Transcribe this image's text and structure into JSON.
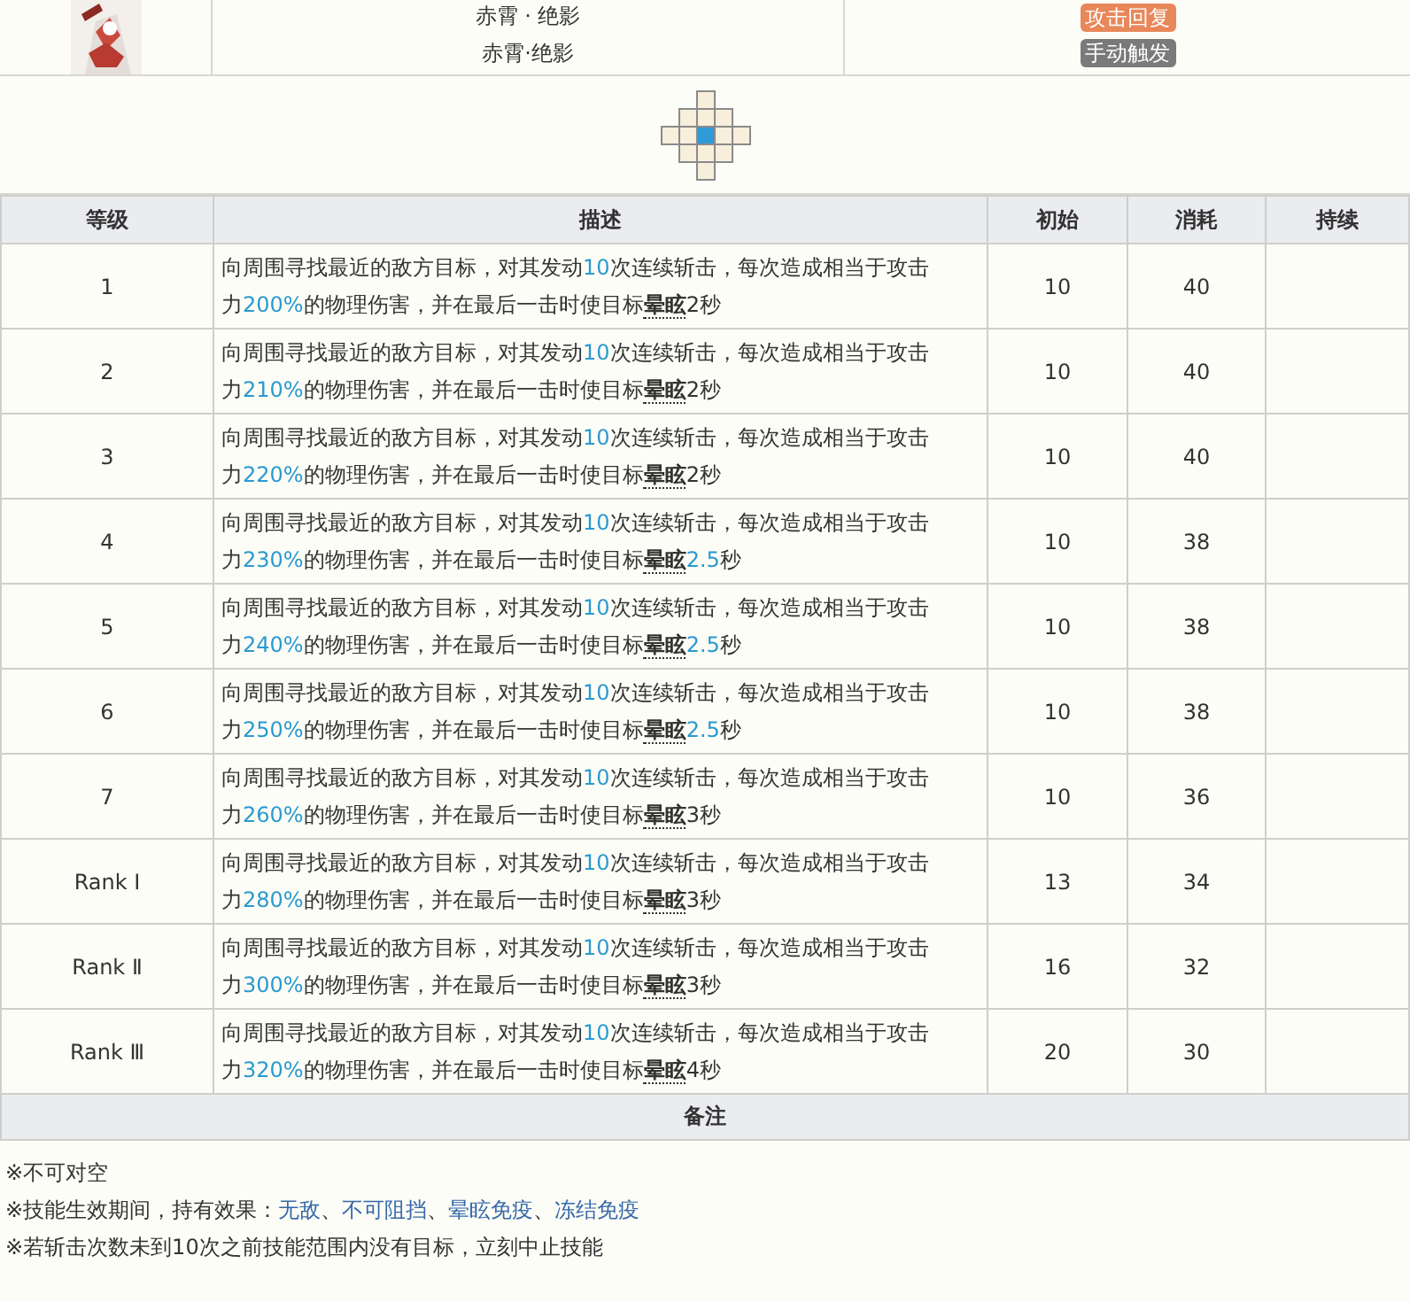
{
  "skill_header": {
    "image": {
      "kind": "picture"
    },
    "names": [
      "赤霄 · 绝影",
      "赤霄·绝影"
    ],
    "tags": [
      {
        "label": "攻击回复",
        "color": "#e8875a"
      },
      {
        "label": "手动触发",
        "color": "#7a7a7a"
      }
    ]
  },
  "range_grid": [
    [
      {
        "in_range": false,
        "self": false
      },
      {
        "in_range": false,
        "self": false
      },
      {
        "in_range": true,
        "self": false
      },
      {
        "in_range": false,
        "self": false
      },
      {
        "in_range": false,
        "self": false
      }
    ],
    [
      {
        "in_range": false,
        "self": false
      },
      {
        "in_range": true,
        "self": false
      },
      {
        "in_range": true,
        "self": false
      },
      {
        "in_range": true,
        "self": false
      },
      {
        "in_range": false,
        "self": false
      }
    ],
    [
      {
        "in_range": true,
        "self": false
      },
      {
        "in_range": true,
        "self": false
      },
      {
        "in_range": true,
        "self": true
      },
      {
        "in_range": true,
        "self": false
      },
      {
        "in_range": true,
        "self": false
      }
    ],
    [
      {
        "in_range": false,
        "self": false
      },
      {
        "in_range": true,
        "self": false
      },
      {
        "in_range": true,
        "self": false
      },
      {
        "in_range": true,
        "self": false
      },
      {
        "in_range": false,
        "self": false
      }
    ],
    [
      {
        "in_range": false,
        "self": false
      },
      {
        "in_range": false,
        "self": false
      },
      {
        "in_range": true,
        "self": false
      },
      {
        "in_range": false,
        "self": false
      },
      {
        "in_range": false,
        "self": false
      }
    ]
  ],
  "table": {
    "columns": [
      "等级",
      "描述",
      "初始",
      "消耗",
      "持续"
    ],
    "rows": [
      {
        "level": "1",
        "description": [
          {
            "kind": "plain",
            "text": "向周围寻找最近的敌方目标，对其发动"
          },
          {
            "kind": "value",
            "text": "10"
          },
          {
            "kind": "plain",
            "text": "次连续斩击，每次造成相当于攻击力"
          },
          {
            "kind": "value",
            "text": "200%"
          },
          {
            "kind": "plain",
            "text": "的物理伤害，并在最后一击时使目标"
          },
          {
            "kind": "term",
            "text": "晕眩"
          },
          {
            "kind": "plain",
            "text": "2秒"
          }
        ],
        "initial": "10",
        "cost": "40"
      },
      {
        "level": "2",
        "description": [
          {
            "kind": "plain",
            "text": "向周围寻找最近的敌方目标，对其发动"
          },
          {
            "kind": "value",
            "text": "10"
          },
          {
            "kind": "plain",
            "text": "次连续斩击，每次造成相当于攻击力"
          },
          {
            "kind": "value",
            "text": "210%"
          },
          {
            "kind": "plain",
            "text": "的物理伤害，并在最后一击时使目标"
          },
          {
            "kind": "term",
            "text": "晕眩"
          },
          {
            "kind": "plain",
            "text": "2秒"
          }
        ],
        "initial": "10",
        "cost": "40"
      },
      {
        "level": "3",
        "description": [
          {
            "kind": "plain",
            "text": "向周围寻找最近的敌方目标，对其发动"
          },
          {
            "kind": "value",
            "text": "10"
          },
          {
            "kind": "plain",
            "text": "次连续斩击，每次造成相当于攻击力"
          },
          {
            "kind": "value",
            "text": "220%"
          },
          {
            "kind": "plain",
            "text": "的物理伤害，并在最后一击时使目标"
          },
          {
            "kind": "term",
            "text": "晕眩"
          },
          {
            "kind": "plain",
            "text": "2秒"
          }
        ],
        "initial": "10",
        "cost": "40"
      },
      {
        "level": "4",
        "description": [
          {
            "kind": "plain",
            "text": "向周围寻找最近的敌方目标，对其发动"
          },
          {
            "kind": "value",
            "text": "10"
          },
          {
            "kind": "plain",
            "text": "次连续斩击，每次造成相当于攻击力"
          },
          {
            "kind": "value",
            "text": "230%"
          },
          {
            "kind": "plain",
            "text": "的物理伤害，并在最后一击时使目标"
          },
          {
            "kind": "term",
            "text": "晕眩"
          },
          {
            "kind": "value",
            "text": "2.5"
          },
          {
            "kind": "plain",
            "text": "秒"
          }
        ],
        "initial": "10",
        "cost": "38"
      },
      {
        "level": "5",
        "description": [
          {
            "kind": "plain",
            "text": "向周围寻找最近的敌方目标，对其发动"
          },
          {
            "kind": "value",
            "text": "10"
          },
          {
            "kind": "plain",
            "text": "次连续斩击，每次造成相当于攻击力"
          },
          {
            "kind": "value",
            "text": "240%"
          },
          {
            "kind": "plain",
            "text": "的物理伤害，并在最后一击时使目标"
          },
          {
            "kind": "term",
            "text": "晕眩"
          },
          {
            "kind": "value",
            "text": "2.5"
          },
          {
            "kind": "plain",
            "text": "秒"
          }
        ],
        "initial": "10",
        "cost": "38"
      },
      {
        "level": "6",
        "description": [
          {
            "kind": "plain",
            "text": "向周围寻找最近的敌方目标，对其发动"
          },
          {
            "kind": "value",
            "text": "10"
          },
          {
            "kind": "plain",
            "text": "次连续斩击，每次造成相当于攻击力"
          },
          {
            "kind": "value",
            "text": "250%"
          },
          {
            "kind": "plain",
            "text": "的物理伤害，并在最后一击时使目标"
          },
          {
            "kind": "term",
            "text": "晕眩"
          },
          {
            "kind": "value",
            "text": "2.5"
          },
          {
            "kind": "plain",
            "text": "秒"
          }
        ],
        "initial": "10",
        "cost": "38"
      },
      {
        "level": "7",
        "description": [
          {
            "kind": "plain",
            "text": "向周围寻找最近的敌方目标，对其发动"
          },
          {
            "kind": "value",
            "text": "10"
          },
          {
            "kind": "plain",
            "text": "次连续斩击，每次造成相当于攻击力"
          },
          {
            "kind": "value",
            "text": "260%"
          },
          {
            "kind": "plain",
            "text": "的物理伤害，并在最后一击时使目标"
          },
          {
            "kind": "term",
            "text": "晕眩"
          },
          {
            "kind": "plain",
            "text": "3秒"
          }
        ],
        "initial": "10",
        "cost": "36"
      },
      {
        "level": "Rank Ⅰ",
        "description": [
          {
            "kind": "plain",
            "text": "向周围寻找最近的敌方目标，对其发动"
          },
          {
            "kind": "value",
            "text": "10"
          },
          {
            "kind": "plain",
            "text": "次连续斩击，每次造成相当于攻击力"
          },
          {
            "kind": "value",
            "text": "280%"
          },
          {
            "kind": "plain",
            "text": "的物理伤害，并在最后一击时使目标"
          },
          {
            "kind": "term",
            "text": "晕眩"
          },
          {
            "kind": "plain",
            "text": "3秒"
          }
        ],
        "initial": "13",
        "cost": "34"
      },
      {
        "level": "Rank Ⅱ",
        "description": [
          {
            "kind": "plain",
            "text": "向周围寻找最近的敌方目标，对其发动"
          },
          {
            "kind": "value",
            "text": "10"
          },
          {
            "kind": "plain",
            "text": "次连续斩击，每次造成相当于攻击力"
          },
          {
            "kind": "value",
            "text": "300%"
          },
          {
            "kind": "plain",
            "text": "的物理伤害，并在最后一击时使目标"
          },
          {
            "kind": "term",
            "text": "晕眩"
          },
          {
            "kind": "plain",
            "text": "3秒"
          }
        ],
        "initial": "16",
        "cost": "32"
      },
      {
        "level": "Rank Ⅲ",
        "description": [
          {
            "kind": "plain",
            "text": "向周围寻找最近的敌方目标，对其发动"
          },
          {
            "kind": "value",
            "text": "10"
          },
          {
            "kind": "plain",
            "text": "次连续斩击，每次造成相当于攻击力"
          },
          {
            "kind": "value",
            "text": "320%"
          },
          {
            "kind": "plain",
            "text": "的物理伤害，并在最后一击时使目标"
          },
          {
            "kind": "term",
            "text": "晕眩"
          },
          {
            "kind": "plain",
            "text": "4秒"
          }
        ],
        "initial": "20",
        "cost": "30"
      }
    ]
  },
  "notes": {
    "title": "备注",
    "lines": [
      [
        {
          "kind": "plain",
          "text": "※不可对空"
        }
      ],
      [
        {
          "kind": "plain",
          "text": "※技能生效期间，持有效果："
        },
        {
          "kind": "link",
          "text": "无敌"
        },
        {
          "kind": "plain",
          "text": "、"
        },
        {
          "kind": "link",
          "text": "不可阻挡"
        },
        {
          "kind": "plain",
          "text": "、"
        },
        {
          "kind": "link",
          "text": "晕眩免疫"
        },
        {
          "kind": "plain",
          "text": "、"
        },
        {
          "kind": "link",
          "text": "冻结免疫"
        }
      ],
      [
        {
          "kind": "plain",
          "text": "※若斩击次数未到10次之前技能范围内没有目标，立刻中止技能"
        }
      ]
    ]
  }
}
